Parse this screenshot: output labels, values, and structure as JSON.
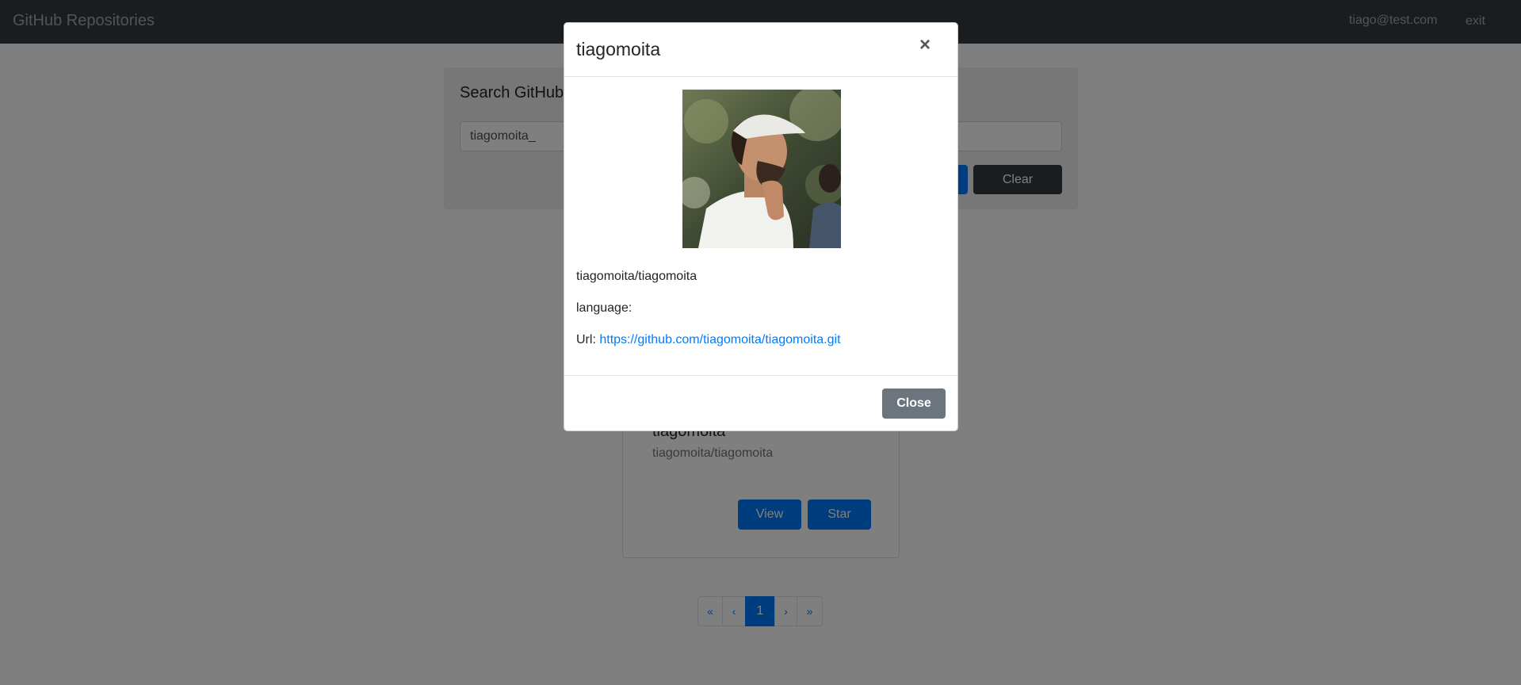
{
  "navbar": {
    "brand": "GitHub Repositories",
    "user_email": "tiago@test.com",
    "exit_label": "exit"
  },
  "search": {
    "title": "Search GitHub",
    "input_value": "tiagomoita_",
    "clear_label": "Clear"
  },
  "result_card": {
    "title": "tiagomoita",
    "full_name": "tiagomoita/tiagomoita",
    "view_label": "View",
    "star_label": "Star"
  },
  "pagination": {
    "first": "«",
    "prev": "‹",
    "current": "1",
    "next": "›",
    "last": "»"
  },
  "modal": {
    "title": "tiagomoita",
    "close_icon": "×",
    "full_name": "tiagomoita/tiagomoita",
    "language_label": "language:",
    "url_label": "Url:",
    "url": "https://github.com/tiagomoita/tiagomoita.git",
    "close_label": "Close"
  },
  "colors": {
    "navbar": "#343a40",
    "primary": "#007bff",
    "secondary": "#6c757d",
    "backdrop": "rgba(0,0,0,0.5)"
  }
}
